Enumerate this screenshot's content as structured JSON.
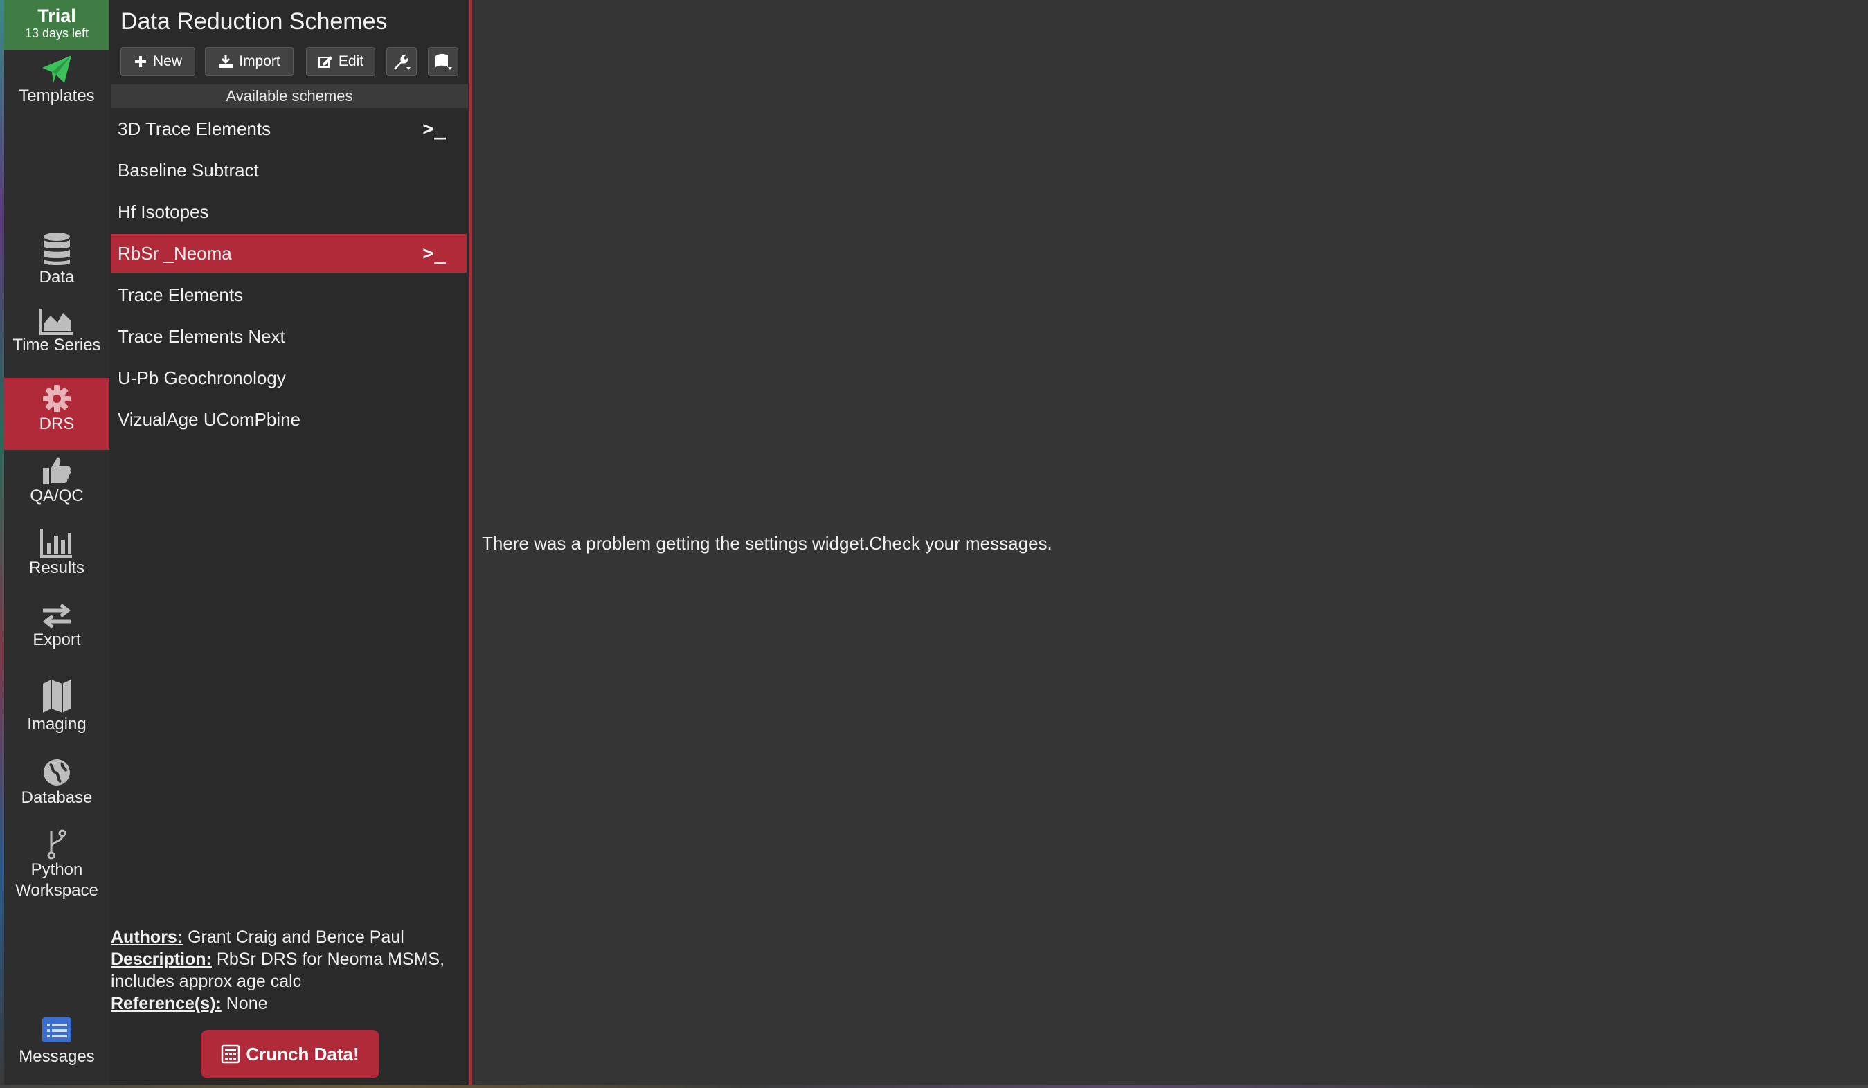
{
  "trial": {
    "label": "Trial",
    "days_left": "13 days left"
  },
  "nav": {
    "templates": "Templates",
    "data": "Data",
    "time_series": "Time Series",
    "drs": "DRS",
    "qaqc": "QA/QC",
    "results": "Results",
    "export": "Export",
    "imaging": "Imaging",
    "database": "Database",
    "python_line1": "Python",
    "python_line2": "Workspace",
    "messages": "Messages"
  },
  "panel": {
    "title": "Data Reduction Schemes",
    "toolbar": {
      "new": "New",
      "import": "Import",
      "edit": "Edit"
    },
    "available_header": "Available schemes",
    "schemes": [
      {
        "label": "3D Trace Elements",
        "prompt": ">_"
      },
      {
        "label": "Baseline Subtract",
        "prompt": ""
      },
      {
        "label": "Hf Isotopes",
        "prompt": ""
      },
      {
        "label": "RbSr _Neoma",
        "prompt": ">_"
      },
      {
        "label": "Trace Elements",
        "prompt": ""
      },
      {
        "label": "Trace Elements Next",
        "prompt": ""
      },
      {
        "label": "U-Pb Geochronology",
        "prompt": ""
      },
      {
        "label": "VizualAge UComPbine",
        "prompt": ""
      }
    ],
    "info": {
      "authors_label": "Authors:",
      "authors": "Grant Craig and Bence Paul",
      "description_label": "Description:",
      "description": "RbSr DRS for Neoma MSMS, includes approx age calc",
      "references_label": "Reference(s):",
      "references": "None"
    },
    "crunch_button": "Crunch Data!"
  },
  "main": {
    "message": "There was a problem getting the settings widget.Check your messages."
  },
  "colors": {
    "accent": "#b02a3a",
    "trial": "#3f7d45",
    "templates_icon": "#3cc15a",
    "messages_icon": "#3a6fd1"
  }
}
